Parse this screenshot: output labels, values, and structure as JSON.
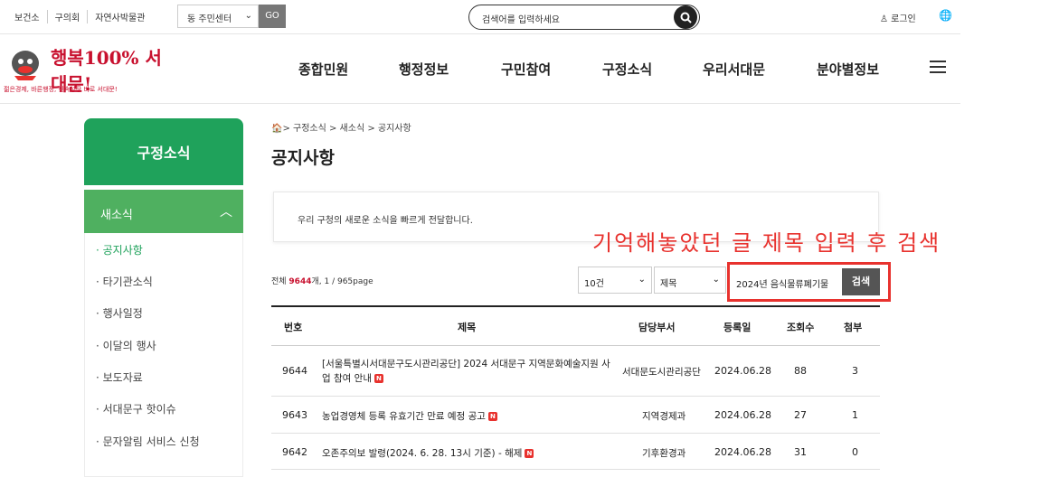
{
  "topbar": {
    "links": [
      "보건소",
      "구의회",
      "자연사박물관"
    ],
    "dong_select": "동 주민센터",
    "go_label": "GO",
    "search_placeholder": "검색어를 입력하세요",
    "login_label": "로그인"
  },
  "logo": {
    "main": "행복100% 서대문!",
    "sub": "젊은경제, 바른행정, 신속성장 바로 서대문!"
  },
  "gnb": [
    "종합민원",
    "행정정보",
    "구민참여",
    "구정소식",
    "우리서대문",
    "분야별정보"
  ],
  "sidebar": {
    "title": "구정소식",
    "section": "새소식",
    "items": [
      "· 공지사항",
      "· 타기관소식",
      "· 행사일정",
      "· 이달의 행사",
      "· 보도자료",
      "· 서대문구 핫이슈",
      "· 문자알림 서비스 신청"
    ]
  },
  "breadcrumb": "> 구정소식 > 새소식 > 공지사항",
  "page_title": "공지사항",
  "intro": "우리 구청의 새로운 소식을 빠르게 전달합니다.",
  "annotation": "기억해놓았던 글 제목 입력 후 검색",
  "list_info": {
    "prefix": "전체 ",
    "total": "9644",
    "suffix": "개, 1 / 965page"
  },
  "filters": {
    "per_page": "10건",
    "field": "제목",
    "keyword": "2024년 음식물류폐기물",
    "search_label": "검색"
  },
  "table": {
    "headers": [
      "번호",
      "제목",
      "담당부서",
      "등록일",
      "조회수",
      "첨부"
    ],
    "rows": [
      {
        "no": "9644",
        "title": "[서울특별시서대문구도시관리공단] 2024 서대문구 지역문화예술지원 사업 참여 안내",
        "dept": "서대문도시관리공단",
        "date": "2024.06.28",
        "views": "88",
        "files": "3"
      },
      {
        "no": "9643",
        "title": "농업경영체 등록 유효기간 만료 예정 공고",
        "dept": "지역경제과",
        "date": "2024.06.28",
        "views": "27",
        "files": "1"
      },
      {
        "no": "9642",
        "title": "오존주의보 발령(2024. 6. 28. 13시 기준) - 해제",
        "dept": "기후환경과",
        "date": "2024.06.28",
        "views": "31",
        "files": "0"
      }
    ],
    "new_badge": "N"
  }
}
